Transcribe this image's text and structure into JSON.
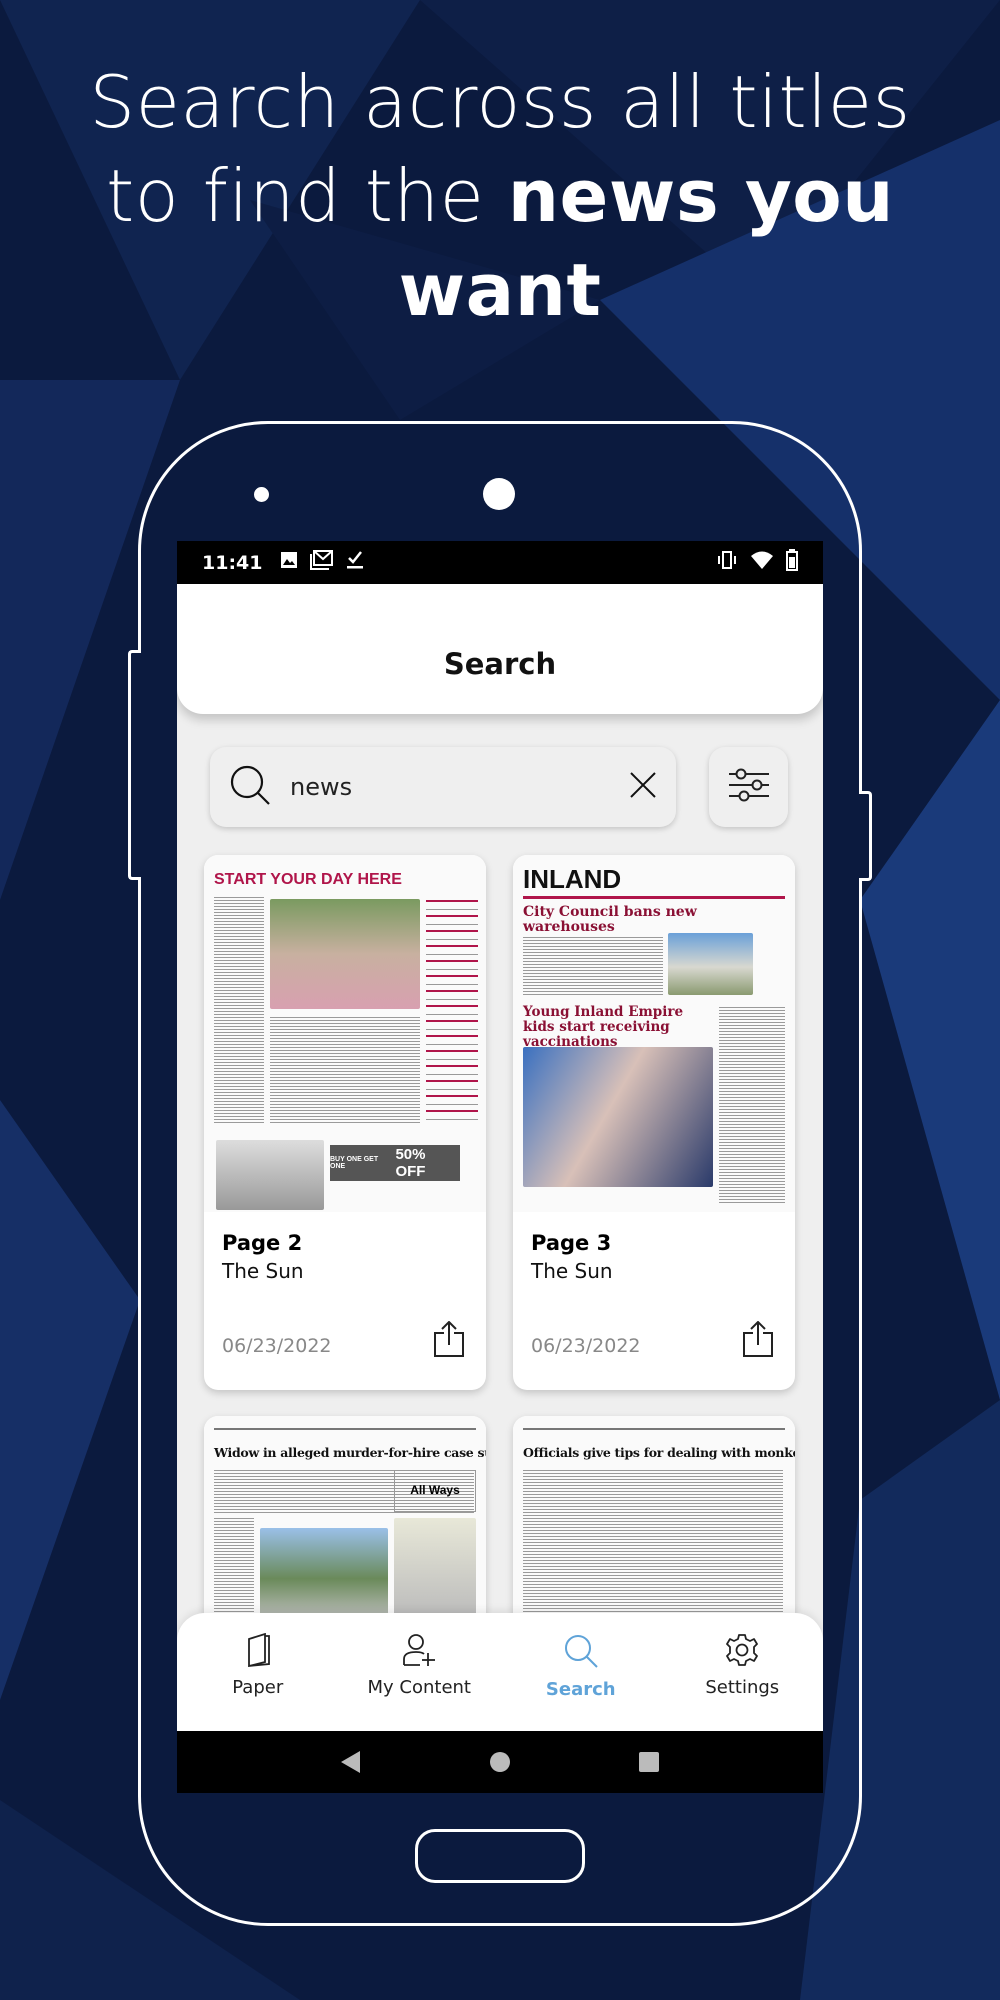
{
  "headline": {
    "line1": "Search across all titles",
    "line2_plain": "to find the ",
    "line2_bold": "news you",
    "line3_bold": "want"
  },
  "status_bar": {
    "time": "11:41",
    "left_icons": [
      "image-icon",
      "gmail-icon",
      "download-done-icon"
    ],
    "right_icons": [
      "vibrate-icon",
      "wifi-icon",
      "battery-icon"
    ]
  },
  "header": {
    "title": "Search"
  },
  "search": {
    "value": "news",
    "icon": "search-icon",
    "clear_icon": "close-icon",
    "filter_icon": "sliders-icon"
  },
  "results": [
    {
      "page": "Page 2",
      "publication": "The Sun",
      "date": "06/23/2022",
      "thumb": {
        "banner": "START YOUR DAY HERE",
        "ad": "50% OFF",
        "ad_top": "BUY ONE GET ONE"
      }
    },
    {
      "page": "Page 3",
      "publication": "The Sun",
      "date": "06/23/2022",
      "thumb": {
        "masthead": "INLAND",
        "headline": "City Council bans new warehouses",
        "headline2": "Young Inland Empire kids start receiving vaccinations"
      }
    },
    {
      "thumb": {
        "headline": "Widow in alleged murder-for-hire case sues suspect",
        "ad": "All Ways"
      }
    },
    {
      "thumb": {
        "headline": "Officials give tips for dealing with monkeypox"
      }
    }
  ],
  "bottom_nav": [
    {
      "label": "Paper",
      "icon": "book-icon"
    },
    {
      "label": "My Content",
      "icon": "user-plus-icon"
    },
    {
      "label": "Search",
      "icon": "search-icon",
      "active": true
    },
    {
      "label": "Settings",
      "icon": "gear-icon"
    }
  ],
  "colors": {
    "background": "#0b1a3e",
    "accent": "#5fa3d8",
    "screen_bg": "#efefef"
  }
}
